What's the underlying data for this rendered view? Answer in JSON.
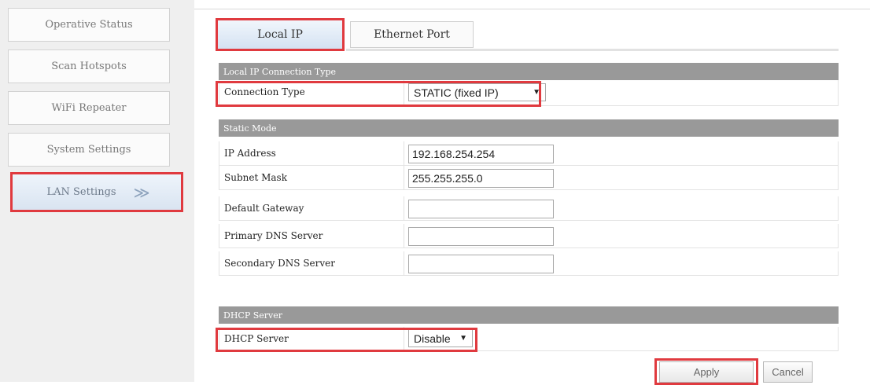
{
  "sidebar": {
    "items": [
      {
        "label": "Operative Status"
      },
      {
        "label": "Scan Hotspots"
      },
      {
        "label": "WiFi Repeater"
      },
      {
        "label": "System Settings"
      },
      {
        "label": "LAN Settings",
        "arrow": "≫"
      }
    ]
  },
  "tabs": [
    {
      "label": "Local IP"
    },
    {
      "label": "Ethernet Port"
    }
  ],
  "connection_section": {
    "title": "Local IP Connection Type",
    "connection_type_label": "Connection Type",
    "connection_type_value": "STATIC (fixed IP)"
  },
  "static_section": {
    "title": "Static Mode",
    "fields": [
      {
        "label": "IP Address",
        "value": "192.168.254.254"
      },
      {
        "label": "Subnet Mask",
        "value": "255.255.255.0"
      },
      {
        "label": "Default Gateway",
        "value": ""
      },
      {
        "label": "Primary DNS Server",
        "value": ""
      },
      {
        "label": "Secondary DNS Server",
        "value": ""
      }
    ]
  },
  "dhcp_section": {
    "title": "DHCP Server",
    "label": "DHCP Server",
    "value": "Disable"
  },
  "buttons": {
    "apply": "Apply",
    "cancel": "Cancel"
  },
  "colors": {
    "highlight": "#e03a3f",
    "section_header": "#999999"
  }
}
